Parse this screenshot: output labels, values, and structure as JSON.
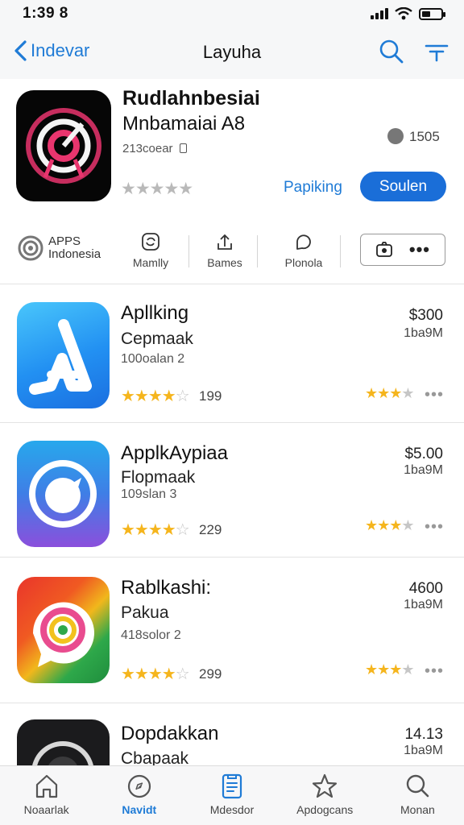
{
  "status": {
    "time": "1:39 8"
  },
  "nav": {
    "back_label": "Indevar",
    "title": "Layuha"
  },
  "hero": {
    "name_line1": "Rudlahnbesiai",
    "name_line2": "Mnbamaiai A8",
    "developer": "213coear",
    "stars": "★★★★★",
    "stars_filled": 0,
    "count": "1505",
    "link_label": "Papiking",
    "button_label": "Soulen"
  },
  "categories": {
    "brand_line1": "APPS",
    "brand_line2": "Indonesia",
    "items": [
      {
        "label": "Mamlly",
        "icon": "refresh-icon"
      },
      {
        "label": "Bames",
        "icon": "upload-icon"
      },
      {
        "label": "Plonola",
        "icon": "chat-bubble-icon"
      }
    ],
    "more_label": "•••"
  },
  "apps": [
    {
      "title": "Apllking",
      "subtitle": "Cepmaak",
      "meta": "100oalan 2",
      "stars": "★★★★",
      "stars_off": "☆",
      "rating_count": "199",
      "price": "$300",
      "size": "1ba9M",
      "right_stars": "★★★",
      "right_stars_off": "★",
      "more": "•••"
    },
    {
      "title": "ApplkAypiaa",
      "subtitle": "Flopmaak",
      "meta": "109slan 3",
      "stars": "★★★★",
      "stars_off": "☆",
      "rating_count": "229",
      "price": "$5.00",
      "size": "1ba9M",
      "right_stars": "★★★",
      "right_stars_off": "★",
      "more": "•••"
    },
    {
      "title": "Rablkashi:",
      "subtitle": "Pakua",
      "meta": "418solor 2",
      "stars": "★★★★",
      "stars_off": "☆",
      "rating_count": "299",
      "price": "4600",
      "size": "1ba9M",
      "right_stars": "★★★",
      "right_stars_off": "★",
      "more": "•••"
    },
    {
      "title": "Dopdakkan",
      "subtitle": "Cbapaak",
      "meta": "",
      "stars": "",
      "stars_off": "",
      "rating_count": "",
      "price": "14.13",
      "size": "1ba9M",
      "right_stars": "",
      "right_stars_off": "",
      "more": ""
    }
  ],
  "tabs": [
    {
      "label": "Noaarlak",
      "icon": "home-icon",
      "active": false
    },
    {
      "label": "Navidt",
      "icon": "compass-icon",
      "active": true
    },
    {
      "label": "Mdesdor",
      "icon": "list-icon",
      "active": false
    },
    {
      "label": "Apdogcans",
      "icon": "star-icon",
      "active": false
    },
    {
      "label": "Monan",
      "icon": "search-icon",
      "active": false
    }
  ],
  "colors": {
    "accent": "#1f7bd6",
    "button": "#1a6ed8",
    "star": "#f5b51d",
    "star_off": "#c6c6c6"
  }
}
